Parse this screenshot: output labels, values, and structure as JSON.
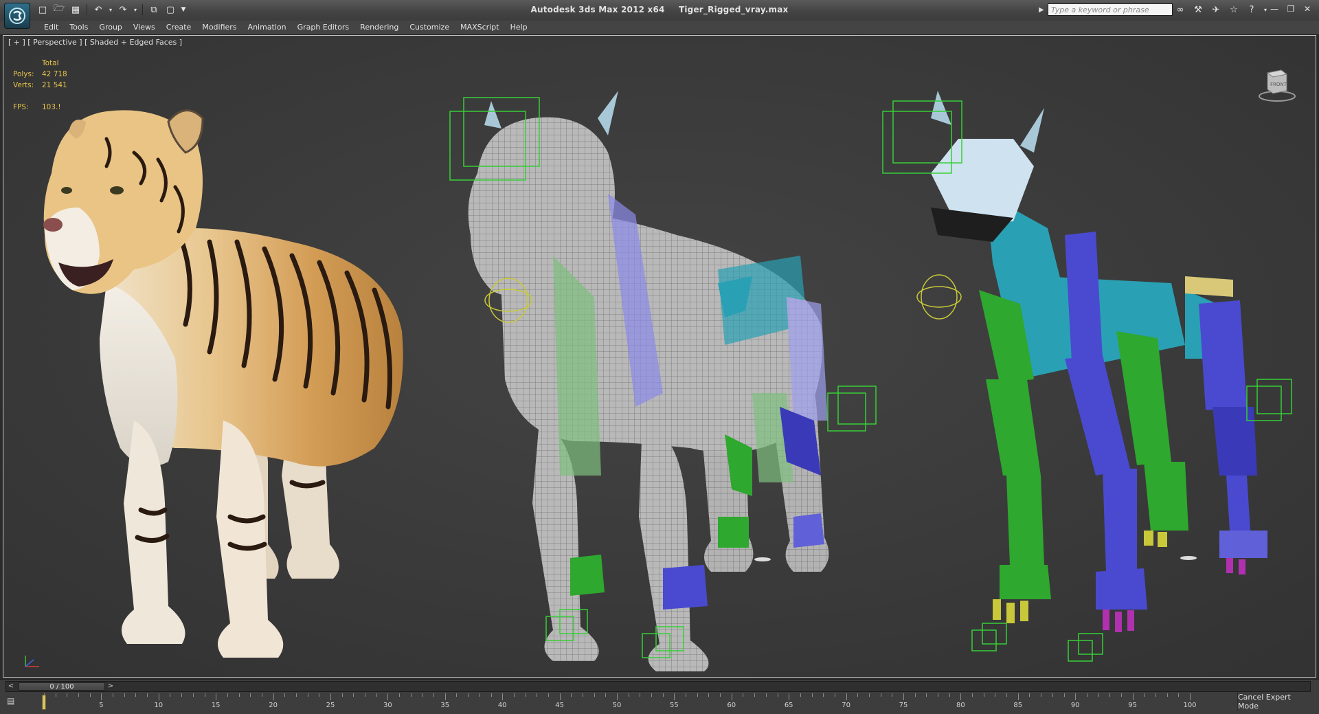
{
  "window": {
    "title_app": "Autodesk 3ds Max  2012 x64",
    "title_file": "Tiger_Rigged_vray.max"
  },
  "quick_access": [
    "new-file-icon",
    "open-folder-icon",
    "save-icon",
    "undo-icon",
    "redo-icon",
    "hold-icon",
    "project-folder-icon",
    "customize-dropdown-icon"
  ],
  "search": {
    "placeholder": "Type a keyword or phrase"
  },
  "right_tools": [
    "binoculars-icon",
    "subscription-icon",
    "communication-center-icon",
    "favorites-star-icon",
    "help-icon"
  ],
  "menu": [
    "Edit",
    "Tools",
    "Group",
    "Views",
    "Create",
    "Modifiers",
    "Animation",
    "Graph Editors",
    "Rendering",
    "Customize",
    "MAXScript",
    "Help"
  ],
  "viewport": {
    "label": "[ + ] [ Perspective ] [ Shaded + Edged Faces ]",
    "viewcube_face": "FRONT"
  },
  "stats": {
    "header": "Total",
    "polys_label": "Polys:",
    "polys_value": "42 718",
    "verts_label": "Verts:",
    "verts_value": "21 541",
    "fps_label": "FPS:",
    "fps_value": "103.!"
  },
  "time_slider": {
    "frame_display": "0 / 100",
    "current_frame": 0,
    "total_frames": 100,
    "ticks": [
      "5",
      "10",
      "15",
      "20",
      "25",
      "30",
      "35",
      "40",
      "45",
      "50",
      "55",
      "60",
      "65",
      "70",
      "75",
      "80",
      "85",
      "90",
      "95",
      "100"
    ]
  },
  "status": {
    "cancel_expert_mode": "Cancel Expert Mode"
  },
  "colors": {
    "viewport_bg": "#3a3a3a",
    "stats_text": "#e6c24a",
    "bone_green": "#2ea82e",
    "bone_blue": "#4a4ad0",
    "bone_cyan": "#2aa0b4",
    "helper_green": "#36d036",
    "helper_yellow": "#c8c83a"
  }
}
